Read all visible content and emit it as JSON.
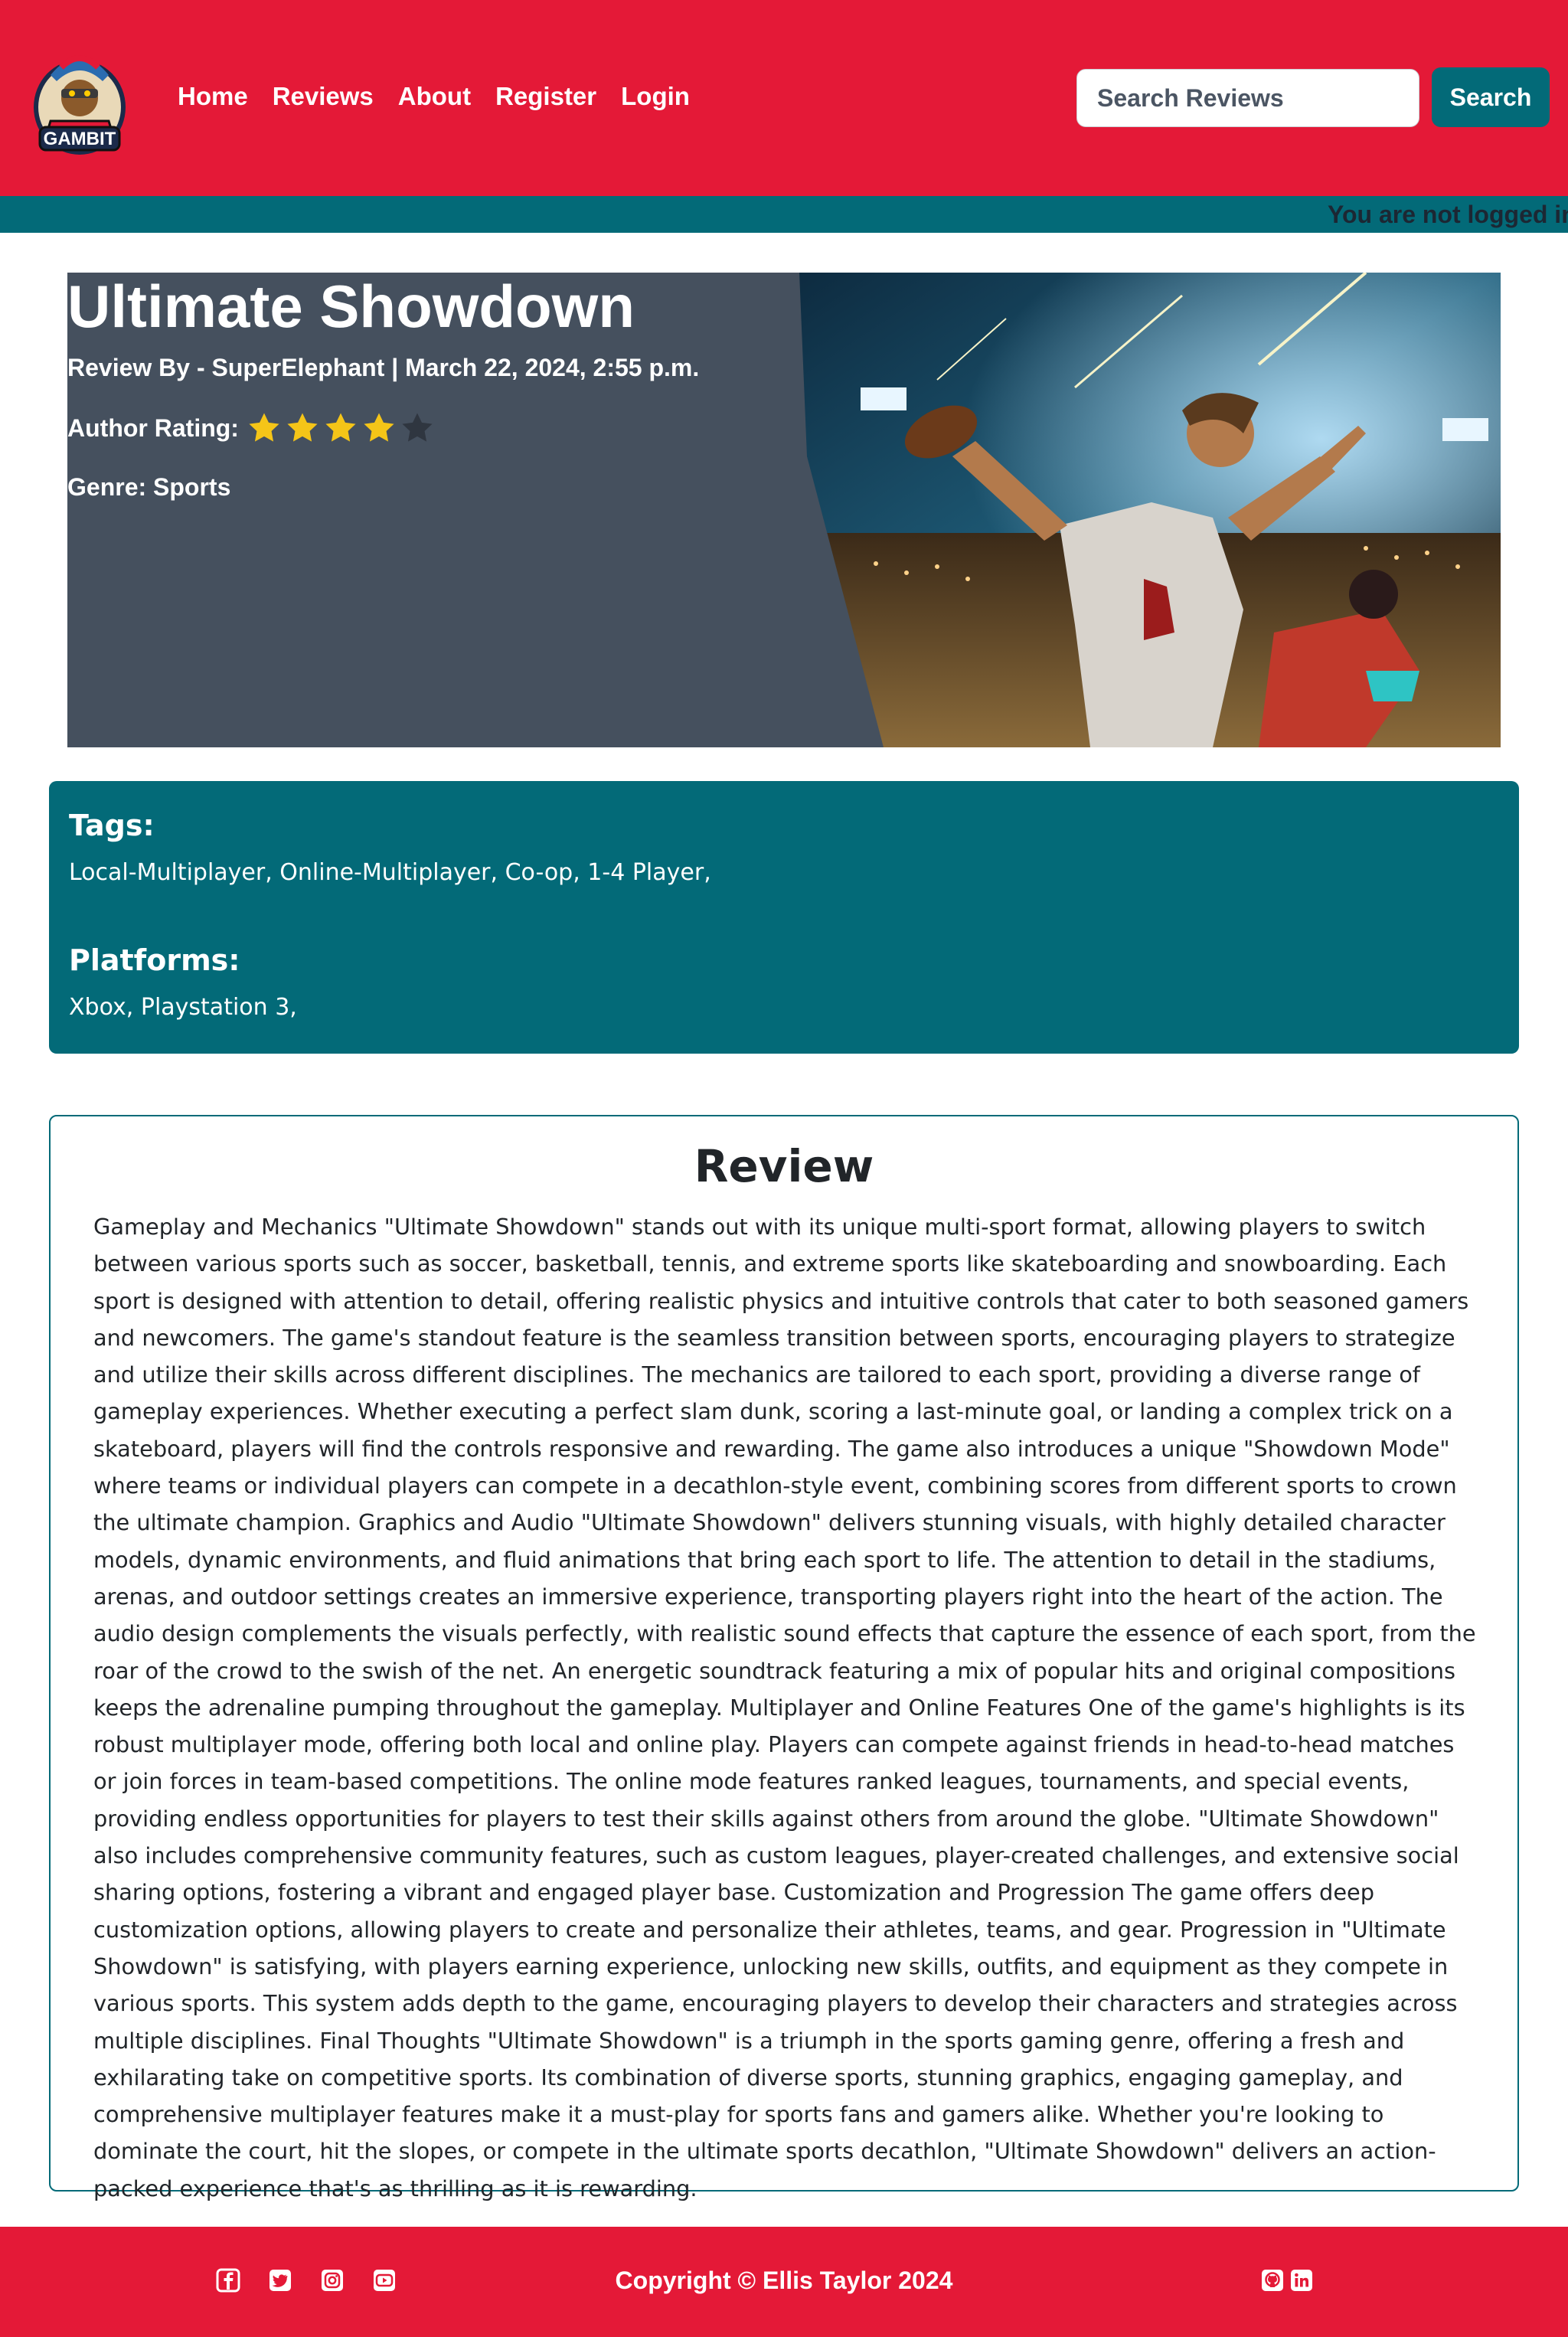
{
  "brand": {
    "logo_text": "GAMBIT",
    "accent_red": "#e41937",
    "accent_teal": "#036a78",
    "hero_bg": "#45505e",
    "star_color": "#f5c518"
  },
  "nav": {
    "links": [
      {
        "label": "Home"
      },
      {
        "label": "Reviews"
      },
      {
        "label": "About"
      },
      {
        "label": "Register"
      },
      {
        "label": "Login"
      }
    ],
    "search": {
      "placeholder": "Search Reviews",
      "button_label": "Search"
    }
  },
  "status": {
    "message": "You are not logged in"
  },
  "review": {
    "title": "Ultimate Showdown",
    "byline": "Review By - SuperElephant | March 22, 2024, 2:55 p.m.",
    "rating_label": "Author Rating:",
    "rating_value": 4,
    "rating_max": 5,
    "genre": "Genre: Sports",
    "tags_heading": "Tags:",
    "tags": "Local-Multiplayer, Online-Multiplayer, Co-op, 1-4 Player,",
    "platforms_heading": "Platforms:",
    "platforms": "Xbox, Playstation 3,",
    "section_title": "Review",
    "body": "Gameplay and Mechanics \"Ultimate Showdown\" stands out with its unique multi-sport format, allowing players to switch between various sports such as soccer, basketball, tennis, and extreme sports like skateboarding and snowboarding. Each sport is designed with attention to detail, offering realistic physics and intuitive controls that cater to both seasoned gamers and newcomers. The game's standout feature is the seamless transition between sports, encouraging players to strategize and utilize their skills across different disciplines. The mechanics are tailored to each sport, providing a diverse range of gameplay experiences. Whether executing a perfect slam dunk, scoring a last-minute goal, or landing a complex trick on a skateboard, players will find the controls responsive and rewarding. The game also introduces a unique \"Showdown Mode\" where teams or individual players can compete in a decathlon-style event, combining scores from different sports to crown the ultimate champion. Graphics and Audio \"Ultimate Showdown\" delivers stunning visuals, with highly detailed character models, dynamic environments, and fluid animations that bring each sport to life. The attention to detail in the stadiums, arenas, and outdoor settings creates an immersive experience, transporting players right into the heart of the action. The audio design complements the visuals perfectly, with realistic sound effects that capture the essence of each sport, from the roar of the crowd to the swish of the net. An energetic soundtrack featuring a mix of popular hits and original compositions keeps the adrenaline pumping throughout the gameplay. Multiplayer and Online Features One of the game's highlights is its robust multiplayer mode, offering both local and online play. Players can compete against friends in head-to-head matches or join forces in team-based competitions. The online mode features ranked leagues, tournaments, and special events, providing endless opportunities for players to test their skills against others from around the globe. \"Ultimate Showdown\" also includes comprehensive community features, such as custom leagues, player-created challenges, and extensive social sharing options, fostering a vibrant and engaged player base. Customization and Progression The game offers deep customization options, allowing players to create and personalize their athletes, teams, and gear. Progression in \"Ultimate Showdown\" is satisfying, with players earning experience, unlocking new skills, outfits, and equipment as they compete in various sports. This system adds depth to the game, encouraging players to develop their characters and strategies across multiple disciplines. Final Thoughts \"Ultimate Showdown\" is a triumph in the sports gaming genre, offering a fresh and exhilarating take on competitive sports. Its combination of diverse sports, stunning graphics, engaging gameplay, and comprehensive multiplayer features make it a must-play for sports fans and gamers alike. Whether you're looking to dominate the court, hit the slopes, or compete in the ultimate sports decathlon, \"Ultimate Showdown\" delivers an action-packed experience that's as thrilling as it is rewarding."
  },
  "footer": {
    "copyright": "Copyright © Ellis Taylor 2024",
    "social_left": [
      "facebook-icon",
      "twitter-icon",
      "instagram-icon",
      "youtube-icon"
    ],
    "social_right": [
      "github-icon",
      "linkedin-icon"
    ]
  }
}
